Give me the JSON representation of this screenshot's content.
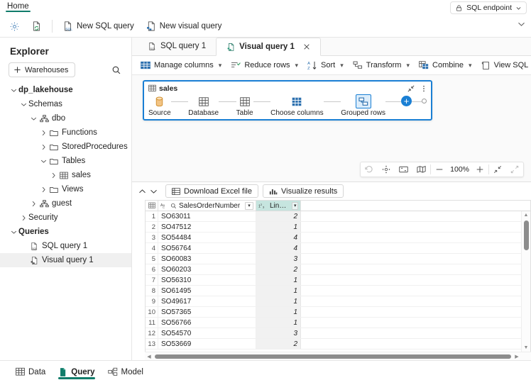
{
  "ribbon": {
    "tabs": [
      {
        "label": "Home",
        "active": true
      }
    ],
    "endpoint": {
      "label": "SQL endpoint",
      "icon": "lock-icon",
      "chevron": "chevron-down-icon"
    },
    "commands": [
      {
        "label": "",
        "icon": "settings-gear-icon"
      },
      {
        "label": "",
        "icon": "refresh-page-icon"
      },
      {
        "label": "New SQL query",
        "icon": "new-sql-query-icon"
      },
      {
        "label": "New visual query",
        "icon": "new-visual-query-icon"
      }
    ],
    "collapse_icon": "chevron-down-icon"
  },
  "explorer": {
    "title": "Explorer",
    "warehouses_button": "Warehouses",
    "add_icon": "plus-icon",
    "search_icon": "search-icon",
    "tree": [
      {
        "label": "dp_lakehouse",
        "level": 0,
        "chevron": "down",
        "icon": "none",
        "bold": true,
        "selected": false
      },
      {
        "label": "Schemas",
        "level": 1,
        "chevron": "down",
        "icon": "none",
        "bold": false,
        "selected": false
      },
      {
        "label": "dbo",
        "level": 2,
        "chevron": "down",
        "icon": "schema-icon",
        "bold": false,
        "selected": false
      },
      {
        "label": "Functions",
        "level": 3,
        "chevron": "right",
        "icon": "folder-icon",
        "bold": false,
        "selected": false
      },
      {
        "label": "StoredProcedures",
        "level": 3,
        "chevron": "right",
        "icon": "folder-icon",
        "bold": false,
        "selected": false
      },
      {
        "label": "Tables",
        "level": 3,
        "chevron": "down",
        "icon": "folder-icon",
        "bold": false,
        "selected": false
      },
      {
        "label": "sales",
        "level": 4,
        "chevron": "right",
        "icon": "table-icon",
        "bold": false,
        "selected": false
      },
      {
        "label": "Views",
        "level": 3,
        "chevron": "right",
        "icon": "folder-icon",
        "bold": false,
        "selected": false
      },
      {
        "label": "guest",
        "level": 2,
        "chevron": "right",
        "icon": "schema-icon",
        "bold": false,
        "selected": false
      },
      {
        "label": "Security",
        "level": 1,
        "chevron": "right",
        "icon": "none",
        "bold": false,
        "selected": false
      },
      {
        "label": "Queries",
        "level": 0,
        "chevron": "down",
        "icon": "none",
        "bold": true,
        "selected": false
      },
      {
        "label": "SQL query 1",
        "level": 1,
        "chevron": "none",
        "icon": "sql-query-icon",
        "bold": false,
        "selected": false
      },
      {
        "label": "Visual query 1",
        "level": 1,
        "chevron": "none",
        "icon": "visual-query-icon",
        "bold": false,
        "selected": true
      }
    ]
  },
  "query_tabs": [
    {
      "label": "SQL query 1",
      "icon": "sql-query-icon",
      "active": false,
      "closable": false
    },
    {
      "label": "Visual query 1",
      "icon": "visual-query-icon",
      "active": true,
      "closable": true,
      "close_icon": "close-icon"
    }
  ],
  "visual_toolbar": [
    {
      "label": "Manage columns",
      "icon": "manage-columns-icon",
      "chevron": true
    },
    {
      "label": "Reduce rows",
      "icon": "reduce-rows-icon",
      "chevron": true
    },
    {
      "label": "Sort",
      "icon": "sort-az-icon",
      "chevron": true
    },
    {
      "label": "Transform",
      "icon": "transform-icon",
      "chevron": true
    },
    {
      "label": "Combine",
      "icon": "combine-icon",
      "chevron": true
    },
    {
      "label": "View SQL",
      "icon": "view-sql-icon",
      "chevron": false
    },
    {
      "label": "",
      "icon": "refresh-icon",
      "chevron": false
    },
    {
      "label": "",
      "icon": "settings-gear-icon",
      "chevron": false
    }
  ],
  "canvas": {
    "node": {
      "title": "sales",
      "title_icon": "table-icon",
      "collapse_icon": "collapse-arrows-icon",
      "more_icon": "more-options-icon",
      "steps": [
        {
          "label": "Source",
          "icon": "database-cylinder-icon",
          "selected": false
        },
        {
          "label": "Database",
          "icon": "grid-icon",
          "selected": false
        },
        {
          "label": "Table",
          "icon": "grid-icon",
          "selected": false
        },
        {
          "label": "Choose columns",
          "icon": "choose-columns-icon",
          "selected": false
        },
        {
          "label": "Grouped rows",
          "icon": "grouped-rows-icon",
          "selected": true
        }
      ],
      "add_step_icon": "plus-circle-icon",
      "end_connector_icon": "connector-dot-icon"
    },
    "zoom_controls": {
      "items": [
        {
          "icon": "reset-icon",
          "dim": true
        },
        {
          "icon": "recenter-icon",
          "dim": false
        },
        {
          "icon": "fit-to-screen-icon",
          "dim": false
        },
        {
          "icon": "mini-map-icon",
          "dim": false
        }
      ],
      "minus_icon": "minus-icon",
      "zoom_level": "100%",
      "plus_icon": "plus-icon",
      "collapse_icon": "collapse-diagonal-icon",
      "expand_icon": "expand-diagonal-icon"
    }
  },
  "results": {
    "collapse_up_icon": "chevron-up-icon",
    "collapse_down_icon": "chevron-down-icon",
    "buttons": [
      {
        "label": "Download Excel file",
        "icon": "excel-file-icon"
      },
      {
        "label": "Visualize results",
        "icon": "bar-chart-icon"
      }
    ],
    "grid": {
      "corner_icon": "select-all-grid-icon",
      "columns": [
        {
          "name": "SalesOrderNumber",
          "type_icon": "abc-text-type-icon",
          "filter_icon": "search-icon",
          "dropdown_icon": "chevron-down-icon",
          "selected": false
        },
        {
          "name": "LineItems",
          "type_icon": "123-number-type-icon",
          "dropdown_icon": "chevron-down-icon",
          "selected": true
        }
      ],
      "rows": [
        {
          "n": "1",
          "SalesOrderNumber": "SO63011",
          "LineItems": "2"
        },
        {
          "n": "2",
          "SalesOrderNumber": "SO47512",
          "LineItems": "1"
        },
        {
          "n": "3",
          "SalesOrderNumber": "SO54484",
          "LineItems": "4"
        },
        {
          "n": "4",
          "SalesOrderNumber": "SO56764",
          "LineItems": "4"
        },
        {
          "n": "5",
          "SalesOrderNumber": "SO60083",
          "LineItems": "3"
        },
        {
          "n": "6",
          "SalesOrderNumber": "SO60203",
          "LineItems": "2"
        },
        {
          "n": "7",
          "SalesOrderNumber": "SO56310",
          "LineItems": "1"
        },
        {
          "n": "8",
          "SalesOrderNumber": "SO61495",
          "LineItems": "1"
        },
        {
          "n": "9",
          "SalesOrderNumber": "SO49617",
          "LineItems": "1"
        },
        {
          "n": "10",
          "SalesOrderNumber": "SO57365",
          "LineItems": "1"
        },
        {
          "n": "11",
          "SalesOrderNumber": "SO56766",
          "LineItems": "1"
        },
        {
          "n": "12",
          "SalesOrderNumber": "SO54570",
          "LineItems": "3"
        },
        {
          "n": "13",
          "SalesOrderNumber": "SO53669",
          "LineItems": "2"
        }
      ]
    }
  },
  "statusbar": [
    {
      "label": "Data",
      "icon": "data-grid-icon",
      "active": false
    },
    {
      "label": "Query",
      "icon": "query-page-icon",
      "active": true
    },
    {
      "label": "Model",
      "icon": "model-icon",
      "active": false
    }
  ],
  "colors": {
    "accent_green": "#107c6a",
    "accent_blue": "#1a7fd4",
    "selected_column_header": "#c6e5df",
    "selected_column_cell": "#f1f1f1",
    "source_icon_orange": "#e8a33d"
  }
}
